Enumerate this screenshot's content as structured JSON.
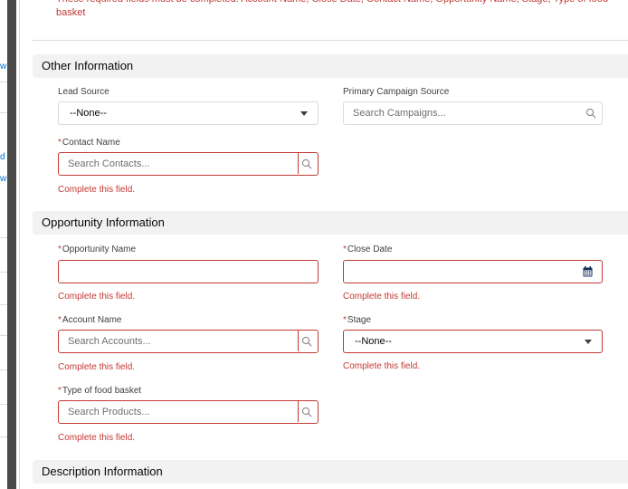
{
  "banner": {
    "text": "These required fields must be completed: Account Name, Close Date, Contact Name, Opportunity Name, Stage, Type of food basket"
  },
  "background_fragments": [
    "w",
    "d",
    "w"
  ],
  "sections": {
    "other": {
      "title": "Other Information"
    },
    "opportunity": {
      "title": "Opportunity Information"
    },
    "description": {
      "title": "Description Information"
    }
  },
  "required_marker": "*",
  "error_text": "Complete this field.",
  "fields": {
    "lead_source": {
      "label": "Lead Source",
      "value": "--None--"
    },
    "primary_campaign": {
      "label": "Primary Campaign Source",
      "placeholder": "Search Campaigns..."
    },
    "contact_name": {
      "label": "Contact Name",
      "placeholder": "Search Contacts..."
    },
    "opportunity_name": {
      "label": "Opportunity Name",
      "value": ""
    },
    "close_date": {
      "label": "Close Date",
      "value": ""
    },
    "account_name": {
      "label": "Account Name",
      "placeholder": "Search Accounts..."
    },
    "stage": {
      "label": "Stage",
      "value": "--None--"
    },
    "food_basket": {
      "label": "Type of food basket",
      "placeholder": "Search Products..."
    }
  },
  "colors": {
    "error": "#c23934",
    "section_bg": "#f3f2f2",
    "border": "#dddbda",
    "link": "#0070d2"
  }
}
